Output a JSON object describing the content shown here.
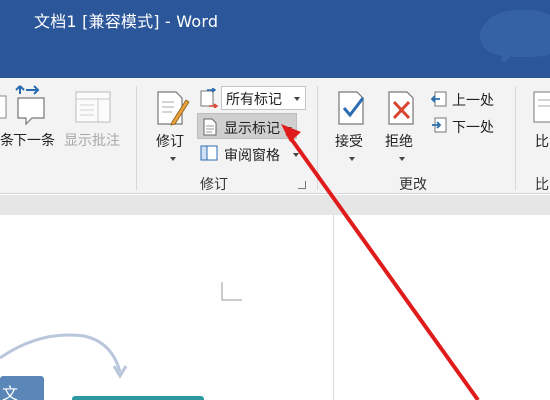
{
  "window": {
    "title": "文档1 [兼容模式] - Word"
  },
  "ribbon": {
    "comments": {
      "prev_label": "条",
      "next_label": "下一条",
      "show_comments_label": "显示批注"
    },
    "tracking": {
      "track_changes_label": "修订",
      "markup_combo_value": "所有标记",
      "show_markup_label": "显示标记",
      "reviewing_pane_label": "审阅窗格",
      "group_label": "修订"
    },
    "changes": {
      "accept_label": "接受",
      "reject_label": "拒绝",
      "previous_label": "上一处",
      "next_label": "下一处",
      "group_label": "更改"
    },
    "compare": {
      "label_top": "比",
      "label_bottom": "比"
    }
  },
  "document": {
    "shape_text": "文"
  },
  "colors": {
    "title_bar": "#2b579a",
    "ribbon_bg": "#f3f3f3",
    "annotation_arrow": "#e01b1b",
    "accent_blue": "#2b6cb0",
    "reject_red": "#d9452f"
  }
}
